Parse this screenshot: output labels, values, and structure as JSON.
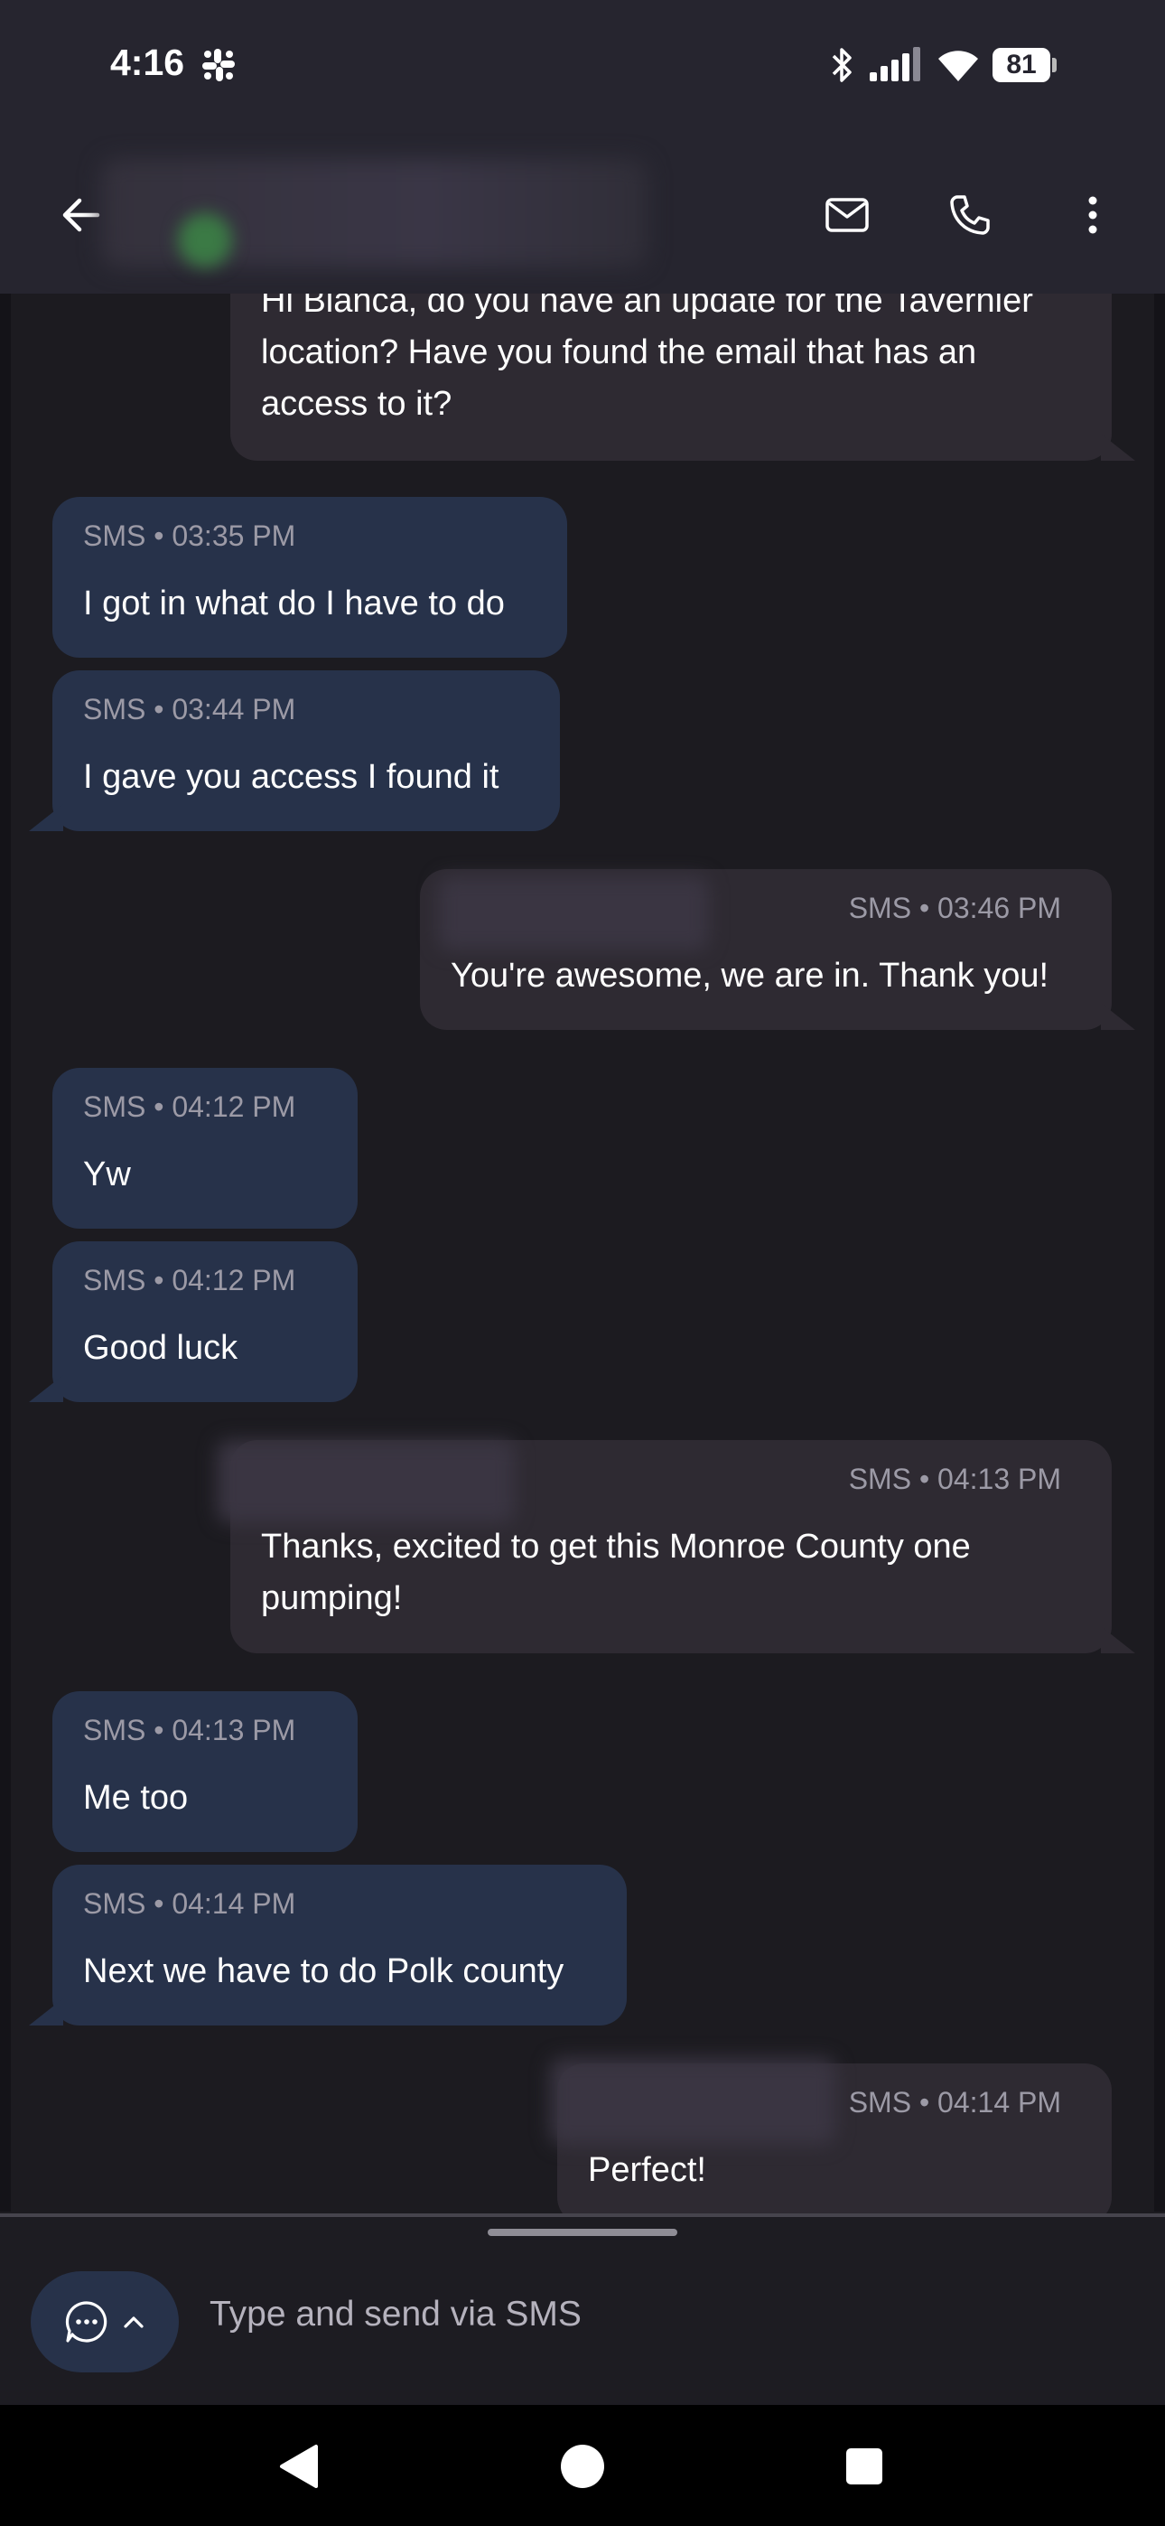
{
  "status_bar": {
    "time": "4:16",
    "battery": "81"
  },
  "app_bar": {
    "contact_name": ""
  },
  "messages": [
    {
      "direction": "out",
      "meta": "",
      "text": "Hi Bianca, do you have an update for the Tavernier location? Have you found the email that has an access to it?"
    },
    {
      "direction": "in",
      "meta": "SMS • 03:35 PM",
      "text": "I got in what do I have to do"
    },
    {
      "direction": "in",
      "meta": "SMS • 03:44 PM",
      "text": "I gave you access I found it"
    },
    {
      "direction": "out",
      "meta": "SMS • 03:46 PM",
      "text": "You're awesome, we are in. Thank you!"
    },
    {
      "direction": "in",
      "meta": "SMS • 04:12 PM",
      "text": "Yw"
    },
    {
      "direction": "in",
      "meta": "SMS • 04:12 PM",
      "text": "Good luck"
    },
    {
      "direction": "out",
      "meta": "SMS • 04:13 PM",
      "text": "Thanks, excited to get this Monroe County one pumping!"
    },
    {
      "direction": "in",
      "meta": "SMS • 04:13 PM",
      "text": "Me too"
    },
    {
      "direction": "in",
      "meta": "SMS • 04:14 PM",
      "text": "Next we have to do Polk county"
    },
    {
      "direction": "out",
      "meta": "SMS • 04:14 PM",
      "text": "Perfect!"
    }
  ],
  "composer": {
    "placeholder": "Type and send via SMS"
  },
  "icons": {
    "status": [
      "slack-icon",
      "bluetooth-icon",
      "signal-icon",
      "wifi-icon",
      "battery-icon"
    ],
    "app_bar": [
      "back-arrow-icon",
      "mail-icon",
      "phone-icon",
      "more-vert-icon"
    ],
    "composer": [
      "chat-bubble-icon",
      "chevron-up-icon"
    ],
    "nav": [
      "nav-back-icon",
      "nav-home-icon",
      "nav-recents-icon"
    ]
  },
  "colors": {
    "background": "#1c1b20",
    "header": "#26252f",
    "incoming_bubble": "#27324a",
    "outgoing_bubble": "#2e2a32",
    "meta_text": "#9c9aa6"
  }
}
